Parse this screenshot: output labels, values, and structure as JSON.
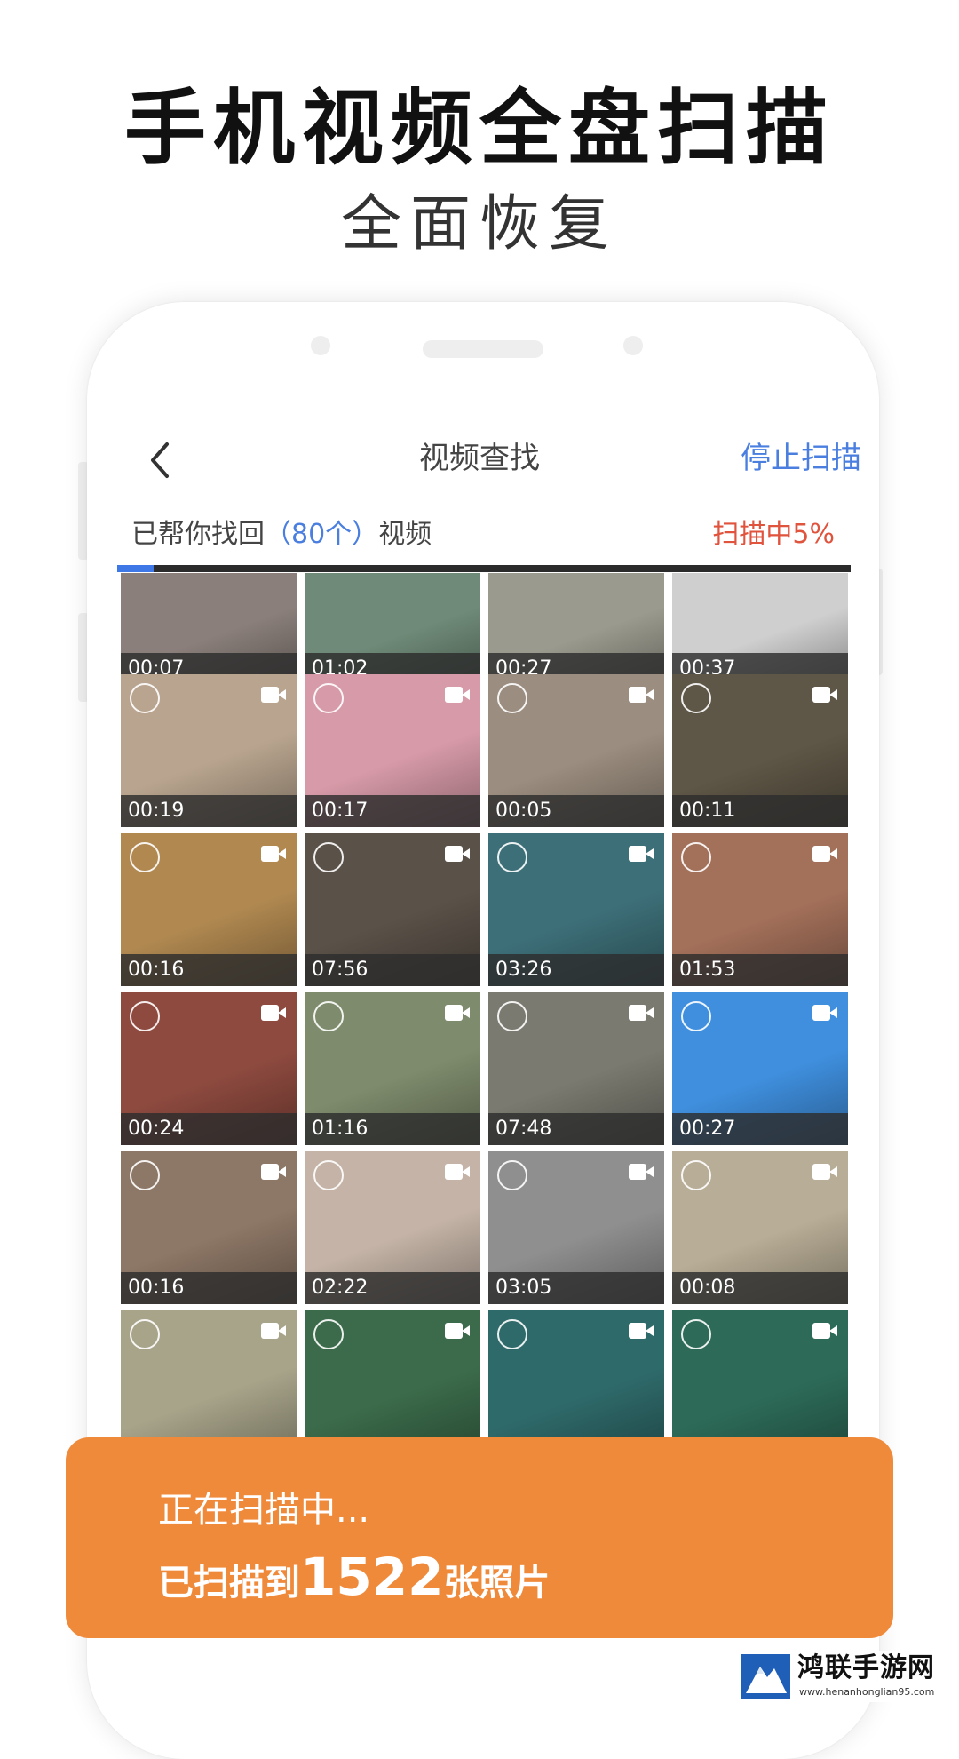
{
  "hero": {
    "title": "手机视频全盘扫描",
    "subtitle": "全面恢复"
  },
  "nav": {
    "back_icon": "chevron-left-icon",
    "title": "视频查找",
    "stop_label": "停止扫描"
  },
  "found": {
    "prefix": "已帮你找回",
    "count": "（80个）",
    "suffix": "视频"
  },
  "scan": {
    "status": "扫描中5%",
    "progress": 0.05
  },
  "videos": [
    {
      "duration": "00:07",
      "color": "#8a7f7a"
    },
    {
      "duration": "01:02",
      "color": "#6f8a78"
    },
    {
      "duration": "00:27",
      "color": "#9a9a8e"
    },
    {
      "duration": "00:37",
      "color": "#cfcfcf"
    },
    {
      "duration": "00:19",
      "color": "#b9a58f"
    },
    {
      "duration": "00:17",
      "color": "#d79aa8"
    },
    {
      "duration": "00:05",
      "color": "#9b8d7f"
    },
    {
      "duration": "00:11",
      "color": "#5e5646"
    },
    {
      "duration": "00:16",
      "color": "#b08850"
    },
    {
      "duration": "07:56",
      "color": "#5a5148"
    },
    {
      "duration": "03:26",
      "color": "#3d6f78"
    },
    {
      "duration": "01:53",
      "color": "#a3705a"
    },
    {
      "duration": "00:24",
      "color": "#8e4a3f"
    },
    {
      "duration": "01:16",
      "color": "#7e8b6c"
    },
    {
      "duration": "07:48",
      "color": "#7a7a70"
    },
    {
      "duration": "00:27",
      "color": "#3f8fde"
    },
    {
      "duration": "00:16",
      "color": "#8d7766"
    },
    {
      "duration": "02:22",
      "color": "#c4b3a6"
    },
    {
      "duration": "03:05",
      "color": "#8f8f8f"
    },
    {
      "duration": "00:08",
      "color": "#b8ad96"
    },
    {
      "duration": "",
      "color": "#a8a48a"
    },
    {
      "duration": "",
      "color": "#3b6b4a"
    },
    {
      "duration": "",
      "color": "#2f6a6a"
    },
    {
      "duration": "",
      "color": "#2d6b58"
    },
    {
      "duration": "",
      "color": "#3e6b5f"
    },
    {
      "duration": "",
      "color": "#356a57"
    },
    {
      "duration": "",
      "color": "#2f6e6a"
    },
    {
      "duration": "",
      "color": "#3b6d5a"
    }
  ],
  "toast": {
    "line1": "正在扫描中...",
    "line2_prefix": "已扫描到",
    "line2_count": "1522",
    "line2_suffix": "张照片"
  },
  "watermark": {
    "name": "鸿联手游网",
    "url": "www.henanhonglian95.com"
  }
}
